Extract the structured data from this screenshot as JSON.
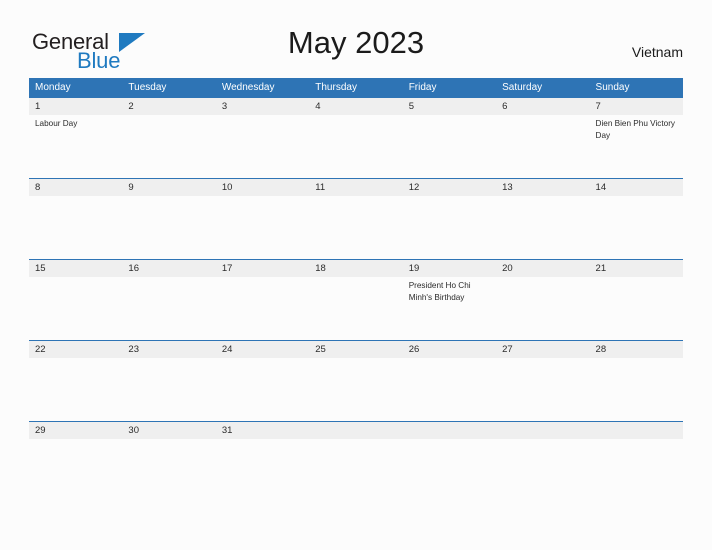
{
  "brand": {
    "name_part1": "General",
    "name_part2": "Blue",
    "triangle_icon": "triangle-icon",
    "color_dark": "#231f20",
    "color_blue": "#1f7ac0"
  },
  "header": {
    "title": "May 2023",
    "region": "Vietnam"
  },
  "theme": {
    "header_blue": "#2e74b5",
    "band_gray": "#efefef",
    "page_background": "#fcfcfc",
    "text_dark": "#2b2b2b"
  },
  "calendar": {
    "weekday_headers": [
      "Monday",
      "Tuesday",
      "Wednesday",
      "Thursday",
      "Friday",
      "Saturday",
      "Sunday"
    ],
    "weeks": [
      {
        "days": [
          {
            "number": "1",
            "event": "Labour Day"
          },
          {
            "number": "2",
            "event": ""
          },
          {
            "number": "3",
            "event": ""
          },
          {
            "number": "4",
            "event": ""
          },
          {
            "number": "5",
            "event": ""
          },
          {
            "number": "6",
            "event": ""
          },
          {
            "number": "7",
            "event": "Dien Bien Phu Victory Day"
          }
        ]
      },
      {
        "days": [
          {
            "number": "8",
            "event": ""
          },
          {
            "number": "9",
            "event": ""
          },
          {
            "number": "10",
            "event": ""
          },
          {
            "number": "11",
            "event": ""
          },
          {
            "number": "12",
            "event": ""
          },
          {
            "number": "13",
            "event": ""
          },
          {
            "number": "14",
            "event": ""
          }
        ]
      },
      {
        "days": [
          {
            "number": "15",
            "event": ""
          },
          {
            "number": "16",
            "event": ""
          },
          {
            "number": "17",
            "event": ""
          },
          {
            "number": "18",
            "event": ""
          },
          {
            "number": "19",
            "event": "President Ho Chi Minh's Birthday"
          },
          {
            "number": "20",
            "event": ""
          },
          {
            "number": "21",
            "event": ""
          }
        ]
      },
      {
        "days": [
          {
            "number": "22",
            "event": ""
          },
          {
            "number": "23",
            "event": ""
          },
          {
            "number": "24",
            "event": ""
          },
          {
            "number": "25",
            "event": ""
          },
          {
            "number": "26",
            "event": ""
          },
          {
            "number": "27",
            "event": ""
          },
          {
            "number": "28",
            "event": ""
          }
        ]
      },
      {
        "days": [
          {
            "number": "29",
            "event": ""
          },
          {
            "number": "30",
            "event": ""
          },
          {
            "number": "31",
            "event": ""
          },
          {
            "number": "",
            "event": ""
          },
          {
            "number": "",
            "event": ""
          },
          {
            "number": "",
            "event": ""
          },
          {
            "number": "",
            "event": ""
          }
        ]
      }
    ]
  }
}
